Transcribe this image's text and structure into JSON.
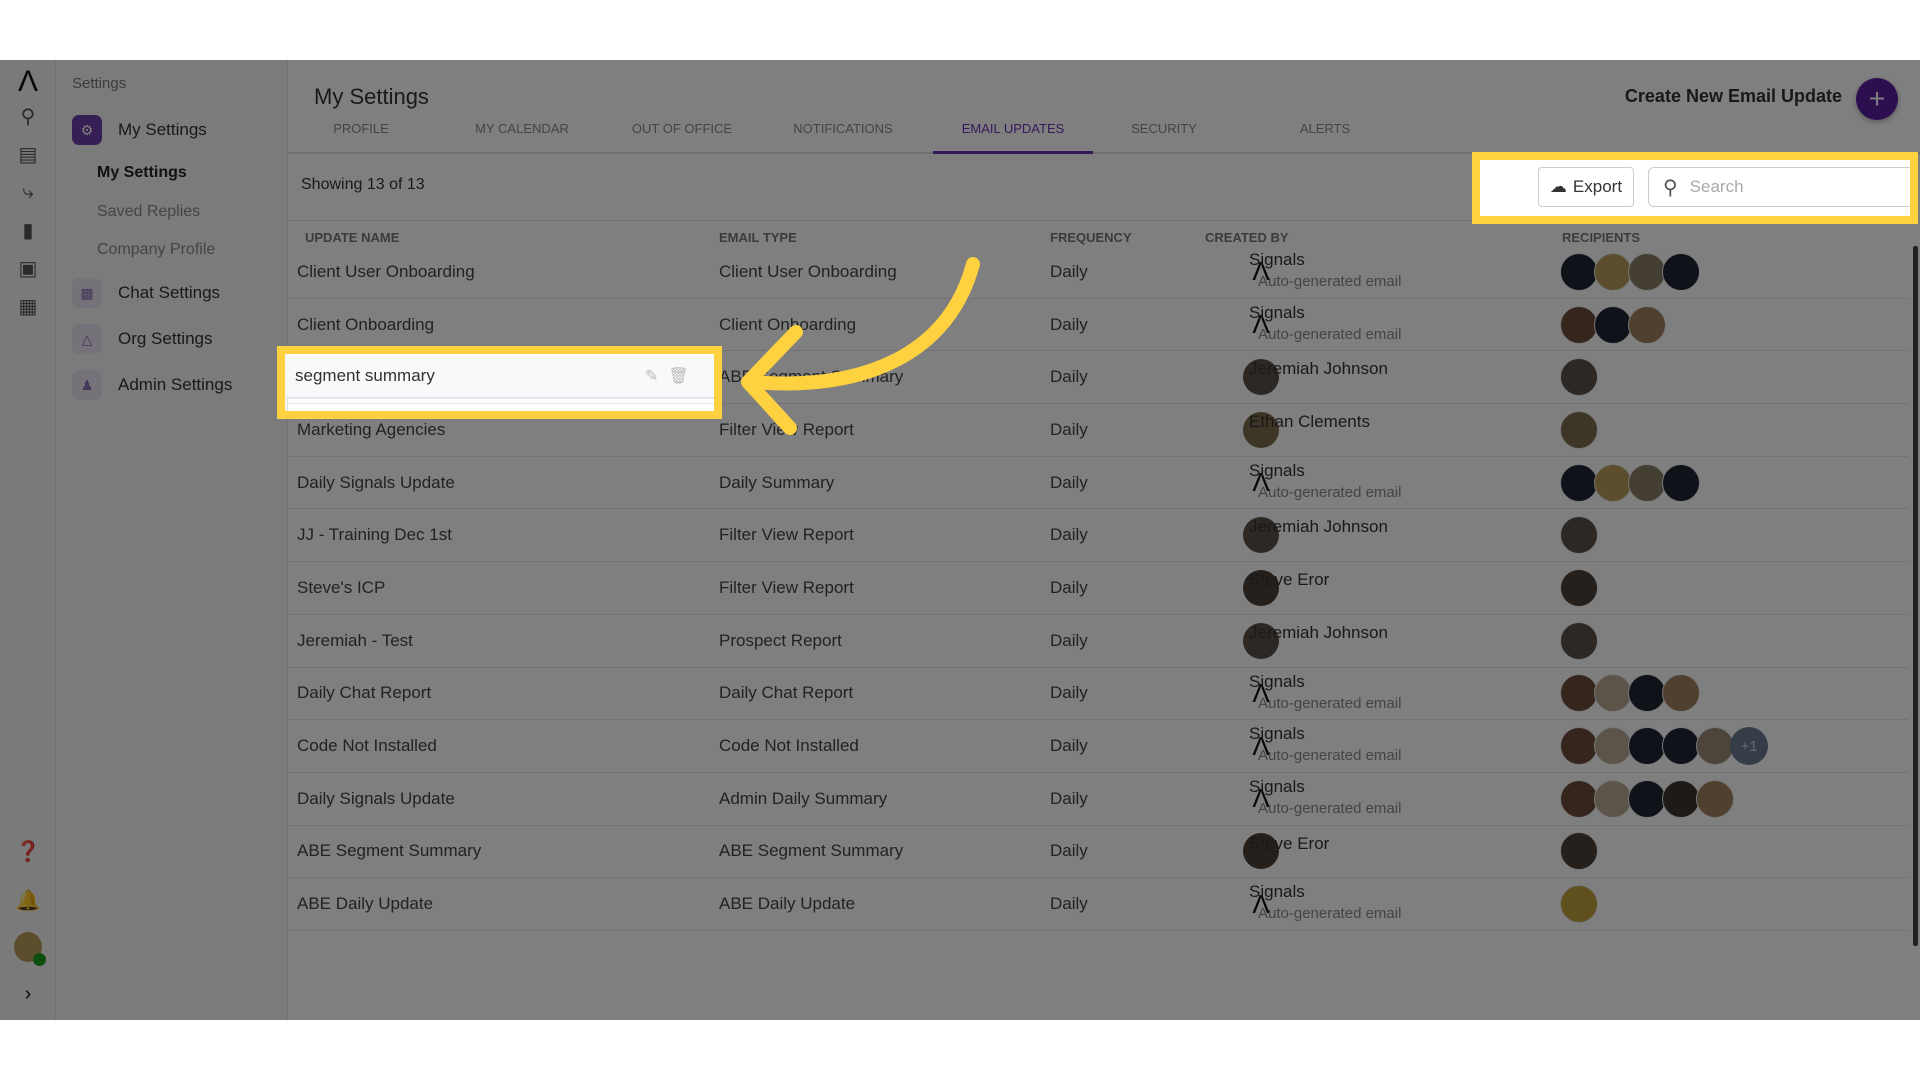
{
  "rail": {
    "logo": "Λ",
    "icons": [
      "globe-search-icon",
      "chat-icon",
      "routing-icon",
      "bar-chart-icon",
      "contacts-icon",
      "building-icon"
    ],
    "bottom_icons": [
      "help-icon",
      "bell-icon",
      "user-avatar",
      "expand-chevron-icon"
    ],
    "expand": "›",
    "status_color": "#1a9c1a"
  },
  "sidebar": {
    "section": "Settings",
    "groups": [
      {
        "label": "My Settings",
        "active": true
      },
      {
        "label": "Chat Settings"
      },
      {
        "label": "Org Settings"
      },
      {
        "label": "Admin Settings"
      }
    ],
    "sub_items": [
      {
        "label": "My Settings",
        "active": true
      },
      {
        "label": "Saved Replies"
      },
      {
        "label": "Company Profile"
      }
    ]
  },
  "header": {
    "title": "My Settings",
    "create_label": "Create New Email Update",
    "create_icon": "+"
  },
  "tabs": [
    "PROFILE",
    "MY CALENDAR",
    "OUT OF OFFICE",
    "NOTIFICATIONS",
    "EMAIL UPDATES",
    "SECURITY",
    "ALERTS"
  ],
  "active_tab": "EMAIL UPDATES",
  "toolbar": {
    "showing": "Showing 13 of 13",
    "export_label": "Export",
    "search_placeholder": "Search"
  },
  "columns": [
    "UPDATE NAME",
    "EMAIL TYPE",
    "FREQUENCY",
    "CREATED BY",
    "RECIPIENTS"
  ],
  "accent": "#6b33b5",
  "highlight_color": "#fdd13f",
  "rows": [
    {
      "name": "Client User Onboarding",
      "type": "Client User Onboarding",
      "freq": "Daily",
      "creator": "Signals",
      "creator_sub": "Auto-generated email",
      "recipients": [
        "#1e2533",
        "#b89a5a",
        "#8a7c66",
        "#1e2533"
      ]
    },
    {
      "name": "Client Onboarding",
      "type": "Client Onboarding",
      "freq": "Daily",
      "creator": "Signals",
      "creator_sub": "Auto-generated email",
      "recipients": [
        "#6b4a3a",
        "#1e2533",
        "#a08060"
      ]
    },
    {
      "name": "segment summary",
      "type": "ABE Segment Summary",
      "freq": "Daily",
      "creator": "Jeremiah Johnson",
      "editing": true,
      "creator_color": "#5a5048",
      "recipients": [
        "#5a5048"
      ]
    },
    {
      "name": "Marketing Agencies",
      "type": "Filter View Report",
      "freq": "Daily",
      "creator": "Ethan Clements",
      "creator_color": "#7b6a4a",
      "recipients": [
        "#7b6a4a"
      ]
    },
    {
      "name": "Daily Signals Update",
      "type": "Daily Summary",
      "freq": "Daily",
      "creator": "Signals",
      "creator_sub": "Auto-generated email",
      "recipients": [
        "#1e2533",
        "#b89a5a",
        "#8a7c66",
        "#1e2533"
      ]
    },
    {
      "name": "JJ - Training Dec 1st",
      "type": "Filter View Report",
      "freq": "Daily",
      "creator": "Jeremiah Johnson",
      "creator_color": "#5a5048",
      "recipients": [
        "#5a5048"
      ]
    },
    {
      "name": "Steve's ICP",
      "type": "Filter View Report",
      "freq": "Daily",
      "creator": "Steve Eror",
      "creator_color": "#4a4038",
      "recipients": [
        "#4a4038"
      ]
    },
    {
      "name": "Jeremiah - Test",
      "type": "Prospect Report",
      "freq": "Daily",
      "creator": "Jeremiah Johnson",
      "creator_color": "#5a5048",
      "recipients": [
        "#5a5048"
      ]
    },
    {
      "name": "Daily Chat Report",
      "type": "Daily Chat Report",
      "freq": "Daily",
      "creator": "Signals",
      "creator_sub": "Auto-generated email",
      "recipients": [
        "#6b4a3a",
        "#b8a890",
        "#1e2533",
        "#a08060"
      ]
    },
    {
      "name": "Code Not Installed",
      "type": "Code Not Installed",
      "freq": "Daily",
      "creator": "Signals",
      "creator_sub": "Auto-generated email",
      "recipients": [
        "#6b4a3a",
        "#b8a890",
        "#1e2533",
        "#1e2533",
        "#9a8a78"
      ],
      "more": "+1"
    },
    {
      "name": "Daily Signals Update",
      "type": "Admin Daily Summary",
      "freq": "Daily",
      "creator": "Signals",
      "creator_sub": "Auto-generated email",
      "recipients": [
        "#6b4a3a",
        "#b8a890",
        "#1e2533",
        "#3a3430",
        "#a08060"
      ]
    },
    {
      "name": "ABE Segment Summary",
      "type": "ABE Segment Summary",
      "freq": "Daily",
      "creator": "Steve Eror",
      "creator_color": "#4a4038",
      "recipients": [
        "#4a4038"
      ]
    },
    {
      "name": "ABE Daily Update",
      "type": "ABE Daily Update",
      "freq": "Daily",
      "creator": "Signals",
      "creator_sub": "Auto-generated email",
      "recipients": [
        "#c0a040"
      ]
    }
  ]
}
